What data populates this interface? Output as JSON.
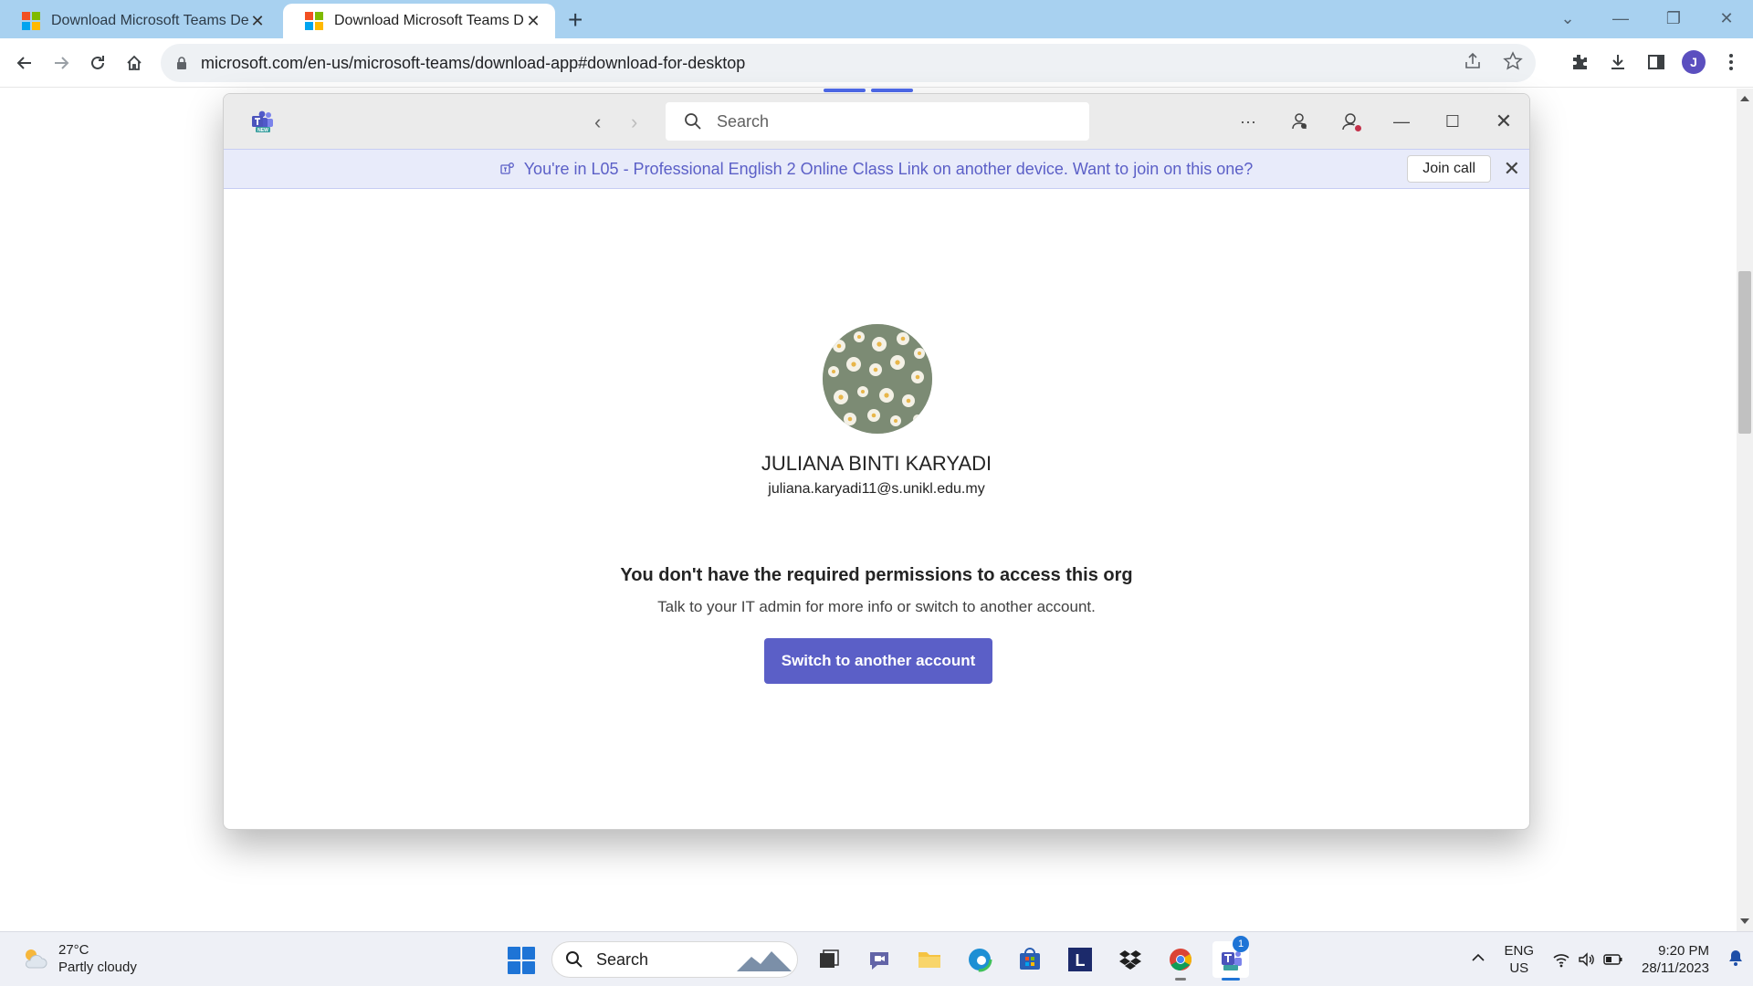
{
  "browser": {
    "tabs": [
      {
        "title": "Download Microsoft Teams Desk",
        "active": false
      },
      {
        "title": "Download Microsoft Teams Desk",
        "active": true
      }
    ],
    "url": "microsoft.com/en-us/microsoft-teams/download-app#download-for-desktop",
    "profile_initial": "J"
  },
  "teams": {
    "search_placeholder": "Search",
    "banner": {
      "text": "You're in L05 - Professional English 2 Online Class Link on another device. Want to join on this one?",
      "join_label": "Join call"
    },
    "user": {
      "name": "JULIANA BINTI KARYADI",
      "email": "juliana.karyadi11@s.unikl.edu.my"
    },
    "error": {
      "title": "You don't have the required permissions to access this org",
      "description": "Talk to your IT admin for more info or switch to another account.",
      "button_label": "Switch to another account"
    },
    "presence_color": "#c4314b",
    "accent_color": "#5b5fc7"
  },
  "taskbar": {
    "weather": {
      "temp": "27°C",
      "condition": "Partly cloudy"
    },
    "search_placeholder": "Search",
    "teams_badge": "1",
    "lang": {
      "line1": "ENG",
      "line2": "US"
    },
    "clock": {
      "time": "9:20 PM",
      "date": "28/11/2023"
    },
    "apps": [
      "task-view",
      "meet",
      "file-explorer",
      "edge",
      "store",
      "l-app",
      "dropbox",
      "chrome",
      "teams"
    ]
  }
}
